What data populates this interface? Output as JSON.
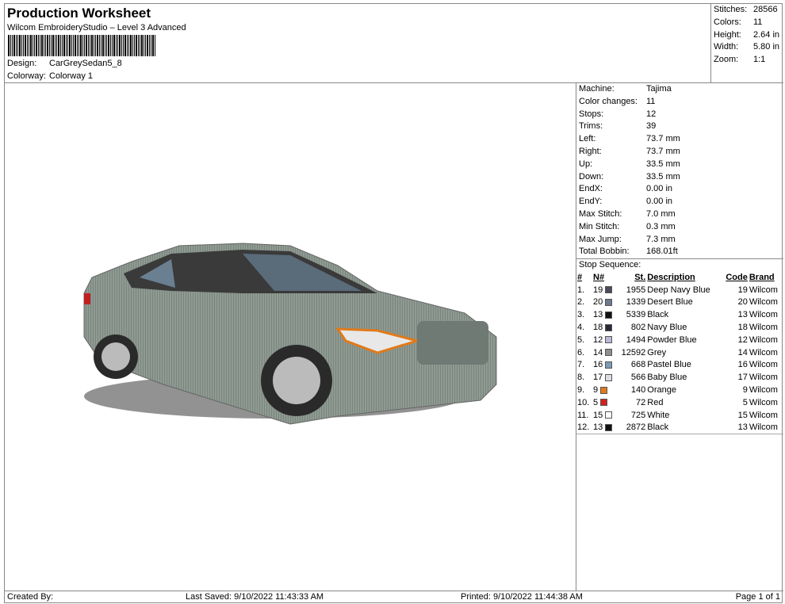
{
  "header": {
    "title": "Production Worksheet",
    "subtitle": "Wilcom EmbroideryStudio – Level 3 Advanced",
    "design_label": "Design:",
    "design": "CarGreySedan5_8",
    "colorway_label": "Colorway:",
    "colorway": "Colorway 1"
  },
  "stats": [
    {
      "k": "Stitches:",
      "v": "28566"
    },
    {
      "k": "Colors:",
      "v": "11"
    },
    {
      "k": "Height:",
      "v": "2.64 in"
    },
    {
      "k": "Width:",
      "v": "5.80 in"
    },
    {
      "k": "Zoom:",
      "v": "1:1"
    }
  ],
  "info": [
    {
      "k": "Machine:",
      "v": "Tajima"
    },
    {
      "k": "Color changes:",
      "v": "11"
    },
    {
      "k": "Stops:",
      "v": "12"
    },
    {
      "k": "Trims:",
      "v": "39"
    },
    {
      "k": "Left:",
      "v": "73.7 mm"
    },
    {
      "k": "Right:",
      "v": "73.7 mm"
    },
    {
      "k": "Up:",
      "v": "33.5 mm"
    },
    {
      "k": "Down:",
      "v": "33.5 mm"
    },
    {
      "k": "EndX:",
      "v": "0.00 in"
    },
    {
      "k": "EndY:",
      "v": "0.00 in"
    },
    {
      "k": "Max Stitch:",
      "v": "7.0 mm"
    },
    {
      "k": "Min Stitch:",
      "v": "0.3 mm"
    },
    {
      "k": "Max Jump:",
      "v": "7.3 mm"
    },
    {
      "k": "Total Bobbin:",
      "v": "168.01ft"
    }
  ],
  "sequence": {
    "label": "Stop Sequence:",
    "columns": [
      "#",
      "N#",
      "St.",
      "Description",
      "Code",
      "Brand"
    ],
    "rows": [
      {
        "i": "1.",
        "n": "19",
        "c": "#4a4c5c",
        "st": "1955",
        "d": "Deep Navy Blue",
        "code": "19",
        "b": "Wilcom"
      },
      {
        "i": "2.",
        "n": "20",
        "c": "#6e7890",
        "st": "1339",
        "d": "Desert Blue",
        "code": "20",
        "b": "Wilcom"
      },
      {
        "i": "3.",
        "n": "13",
        "c": "#111111",
        "st": "5339",
        "d": "Black",
        "code": "13",
        "b": "Wilcom"
      },
      {
        "i": "4.",
        "n": "18",
        "c": "#252a36",
        "st": "802",
        "d": "Navy Blue",
        "code": "18",
        "b": "Wilcom"
      },
      {
        "i": "5.",
        "n": "12",
        "c": "#b8b8d8",
        "st": "1494",
        "d": "Powder Blue",
        "code": "12",
        "b": "Wilcom"
      },
      {
        "i": "6.",
        "n": "14",
        "c": "#8a9090",
        "st": "12592",
        "d": "Grey",
        "code": "14",
        "b": "Wilcom"
      },
      {
        "i": "7.",
        "n": "16",
        "c": "#7e9ab4",
        "st": "668",
        "d": "Pastel Blue",
        "code": "16",
        "b": "Wilcom"
      },
      {
        "i": "8.",
        "n": "17",
        "c": "#dcdce6",
        "st": "566",
        "d": "Baby Blue",
        "code": "17",
        "b": "Wilcom"
      },
      {
        "i": "9.",
        "n": "9",
        "c": "#e07a1a",
        "st": "140",
        "d": "Orange",
        "code": "9",
        "b": "Wilcom"
      },
      {
        "i": "10.",
        "n": "5",
        "c": "#d42020",
        "st": "72",
        "d": "Red",
        "code": "5",
        "b": "Wilcom"
      },
      {
        "i": "11.",
        "n": "15",
        "c": "#ffffff",
        "st": "725",
        "d": "White",
        "code": "15",
        "b": "Wilcom"
      },
      {
        "i": "12.",
        "n": "13",
        "c": "#111111",
        "st": "2872",
        "d": "Black",
        "code": "13",
        "b": "Wilcom"
      }
    ]
  },
  "footer": {
    "created": "Created By:",
    "saved": "Last Saved: 9/10/2022 11:43:33 AM",
    "printed": "Printed: 9/10/2022 11:44:38 AM",
    "page": "Page 1 of 1"
  }
}
